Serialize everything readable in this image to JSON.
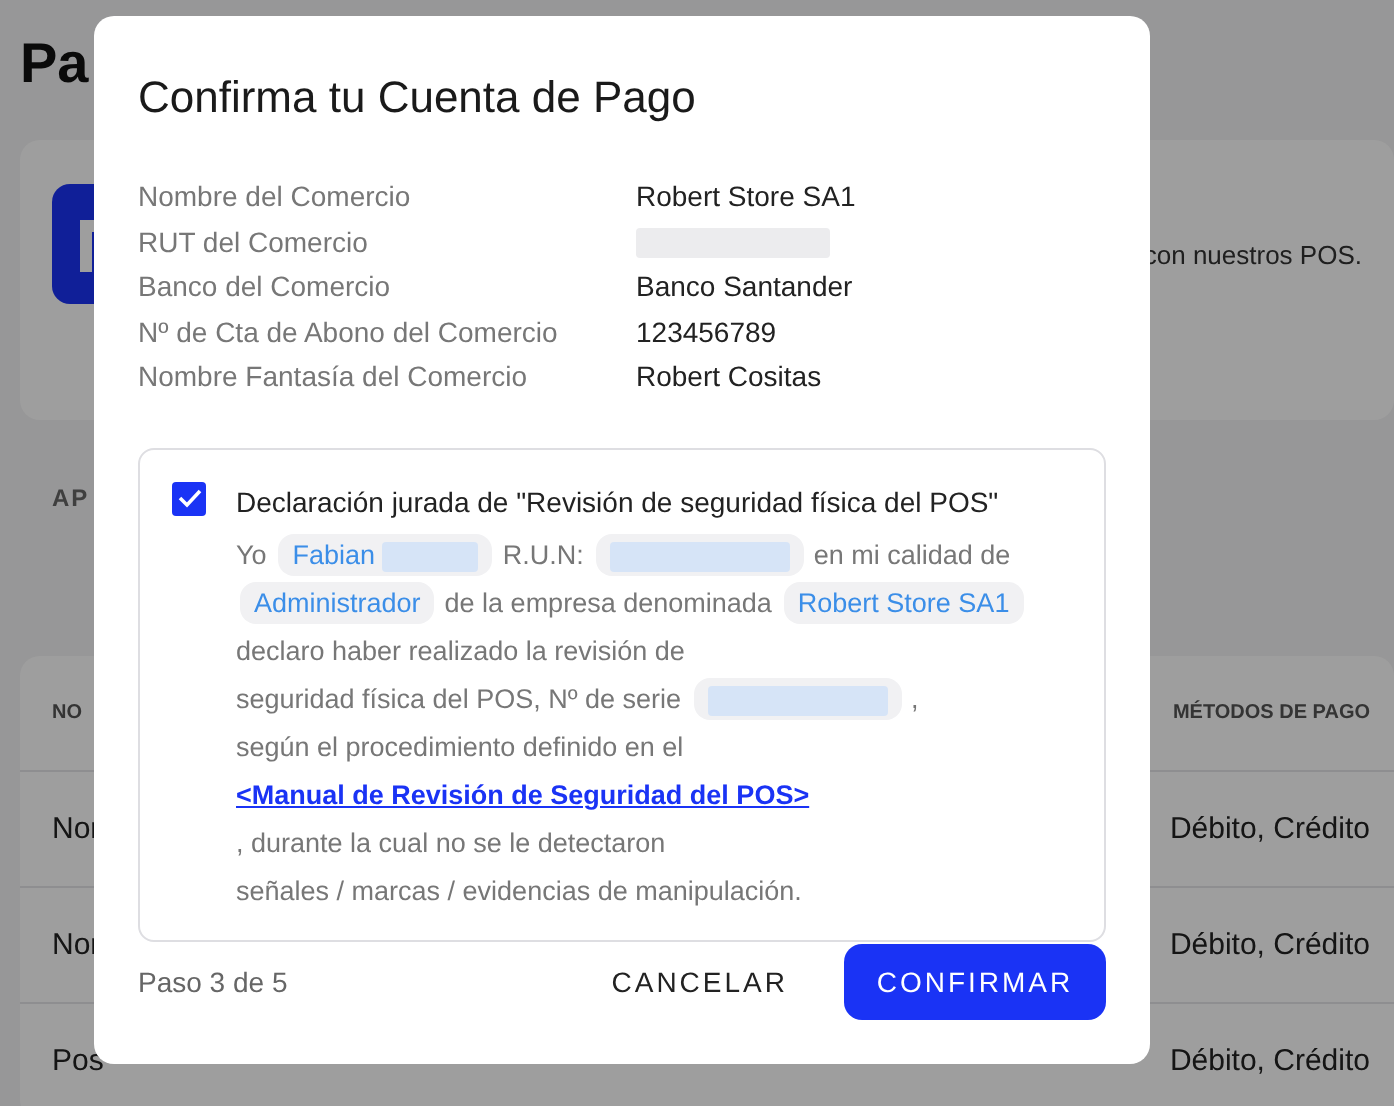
{
  "page": {
    "title": "Pa",
    "card_text": "con nuestros POS.",
    "section_label": "AP",
    "table": {
      "columns": [
        "NO",
        "MÉTODOS DE PAGO"
      ],
      "rows": [
        {
          "name": "Nor",
          "methods": "Débito, Crédito"
        },
        {
          "name": "Nor",
          "methods": "Débito, Crédito"
        },
        {
          "name": "Pos",
          "methods": "Débito, Crédito"
        }
      ]
    }
  },
  "dialog": {
    "title": "Confirma tu Cuenta de Pago",
    "details": [
      {
        "label": "Nombre del Comercio",
        "value": "Robert Store SA1",
        "blurred": false
      },
      {
        "label": "RUT del Comercio",
        "blurred": true
      },
      {
        "label": "Banco del Comercio",
        "value": "Banco Santander",
        "blurred": false
      },
      {
        "label": "Nº de Cta de Abono del Comercio",
        "value": "123456789",
        "blurred": false
      },
      {
        "label": "Nombre Fantasía del Comercio",
        "value": "Robert Cositas",
        "blurred": false
      }
    ],
    "declaration": {
      "checked": true,
      "heading": "Declaración jurada de \"Revisión de seguridad física del POS\"",
      "segments": [
        {
          "kind": "text",
          "text": "Yo"
        },
        {
          "kind": "chip",
          "text": "Fabian",
          "blurred": true
        },
        {
          "kind": "text",
          "text": "R.U.N:"
        },
        {
          "kind": "chip",
          "blurred": true
        },
        {
          "kind": "text",
          "text": "en mi calidad de"
        },
        {
          "kind": "chip",
          "text": "Administrador",
          "blurred": false
        },
        {
          "kind": "text",
          "text": "de la empresa denominada"
        },
        {
          "kind": "chip",
          "text": "Robert Store SA1",
          "blurred": false
        },
        {
          "kind": "text",
          "text": "declaro haber realizado la revisión de"
        },
        {
          "kind": "text",
          "text": "seguridad física del POS, Nº de serie"
        },
        {
          "kind": "chip",
          "blurred": true
        },
        {
          "kind": "text",
          "text": ","
        },
        {
          "kind": "text",
          "text": "según el procedimiento definido en el"
        },
        {
          "kind": "link",
          "text": "<Manual de Revisión de Seguridad del POS>"
        },
        {
          "kind": "text",
          "text": ", durante la cual no se le detectaron"
        },
        {
          "kind": "text",
          "text": "señales / marcas / evidencias de manipulación."
        }
      ]
    },
    "step": "Paso 3 de 5",
    "cancel": "CANCELAR",
    "confirm": "CONFIRMAR"
  }
}
